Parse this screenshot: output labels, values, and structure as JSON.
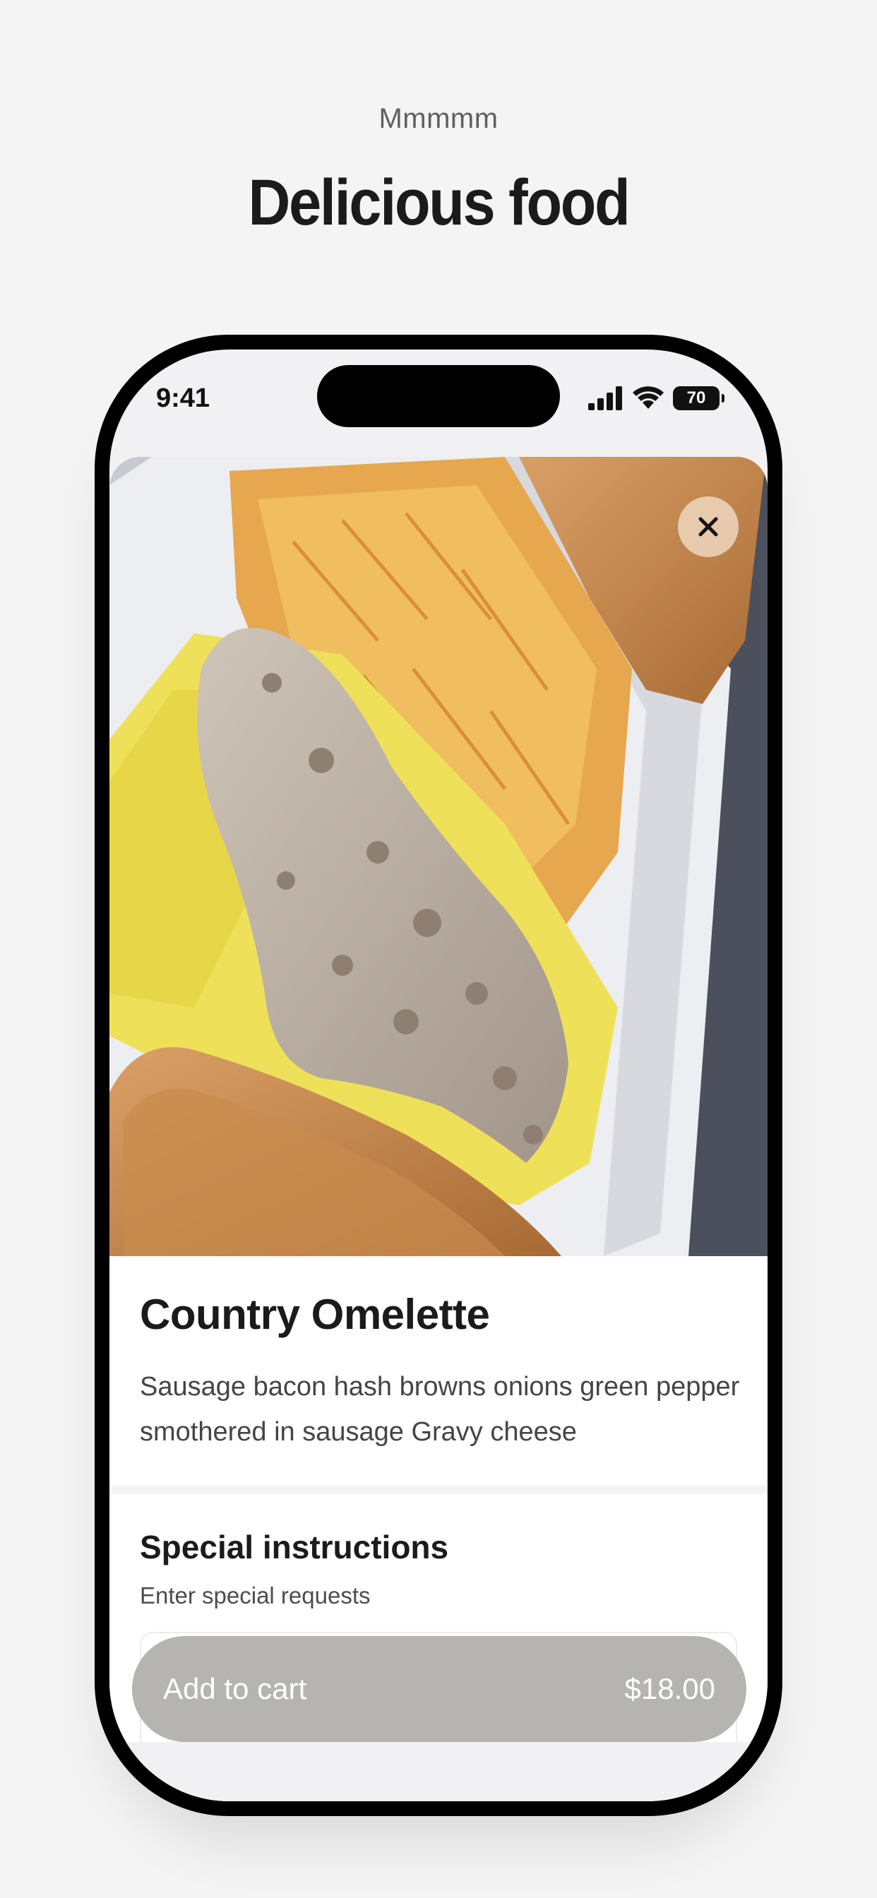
{
  "promo": {
    "eyebrow": "Mmmmm",
    "title": "Delicious food"
  },
  "status_bar": {
    "time": "9:41",
    "battery": "70"
  },
  "item": {
    "image_icon": "food-photo",
    "name": "Country Omelette",
    "description": "Sausage bacon hash browns onions green pepper smothered in sausage Gravy cheese"
  },
  "special_instructions": {
    "title": "Special instructions",
    "placeholder": "Enter special requests"
  },
  "cart_button": {
    "label": "Add to cart",
    "price": "$18.00"
  },
  "colors": {
    "button_bg": "#b5b4b1",
    "page_bg": "#f4f4f4",
    "close_bg": "#eed6be"
  }
}
